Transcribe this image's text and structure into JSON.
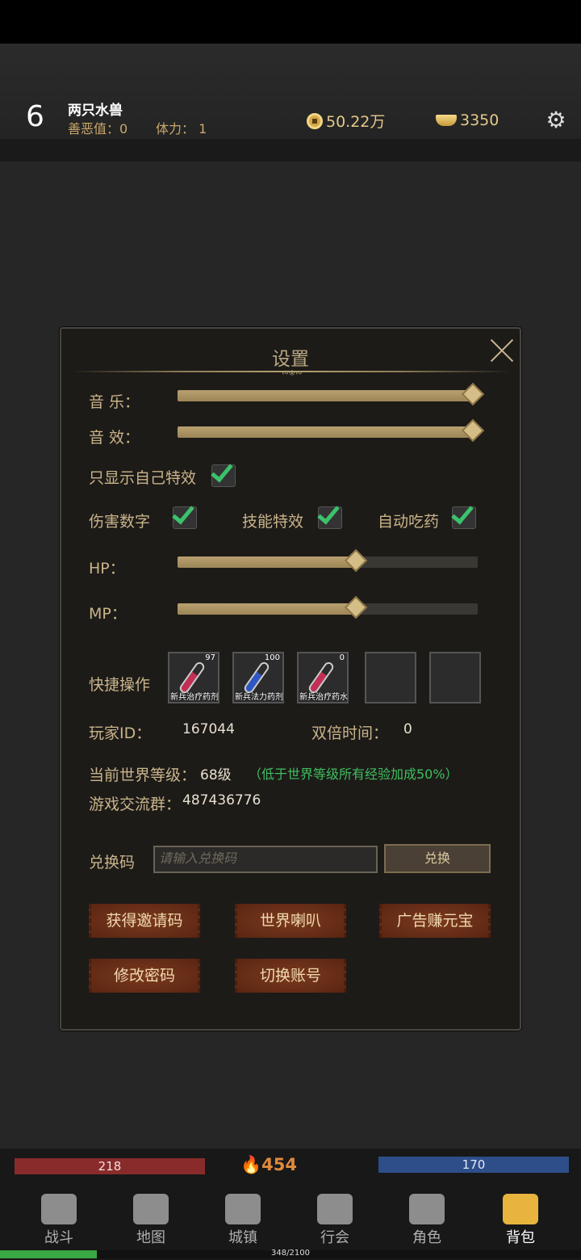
{
  "player": {
    "level": "6",
    "name": "两只水兽",
    "karma": "善恶值：0",
    "stamina": "体力：  1"
  },
  "currency": {
    "coins": "50.22万",
    "gold": "3350"
  },
  "settings": {
    "title": "设置",
    "music_label": "音 乐：",
    "sfx_label": "音 效：",
    "music_level": 1.0,
    "sfx_level": 1.0,
    "only_self_effects_label": "只显示自己特效",
    "only_self_effects": true,
    "damage_numbers_label": "伤害数字",
    "damage_numbers": true,
    "skill_effects_label": "技能特效",
    "skill_effects": true,
    "auto_potion_label": "自动吃药",
    "auto_potion": true,
    "hp_label": "HP：",
    "mp_label": "MP：",
    "hp_threshold": 0.6,
    "mp_threshold": 0.6,
    "quick_label": "快捷操作",
    "quick_slots": [
      {
        "name": "新兵治疗药剂",
        "count": "97",
        "color": "#c22f55"
      },
      {
        "name": "新兵法力药剂",
        "count": "100",
        "color": "#2f56c2"
      },
      {
        "name": "新兵治疗药水",
        "count": "0",
        "color": "#c22f55"
      }
    ],
    "player_id_label": "玩家ID：",
    "player_id": "167044",
    "double_time_label": "双倍时间：",
    "double_time": "0",
    "world_level_label": "当前世界等级：",
    "world_level": "68级",
    "world_level_note": "（低于世界等级所有经验加成50%）",
    "group_label": "游戏交流群：",
    "group": "487436776",
    "redeem_label": "兑换码",
    "redeem_placeholder": "请输入兑换码",
    "redeem_button": "兑换",
    "buttons": {
      "invite": "获得邀请码",
      "horn": "世界喇叭",
      "ad": "广告赚元宝",
      "password": "修改密码",
      "switch": "切换账号"
    }
  },
  "bottom": {
    "hp": "218",
    "mp": "170",
    "power": "454",
    "xp": "348/2100",
    "xp_progress": 0.166,
    "nav": [
      "战斗",
      "地图",
      "城镇",
      "行会",
      "角色",
      "背包"
    ],
    "active_nav": "背包"
  }
}
